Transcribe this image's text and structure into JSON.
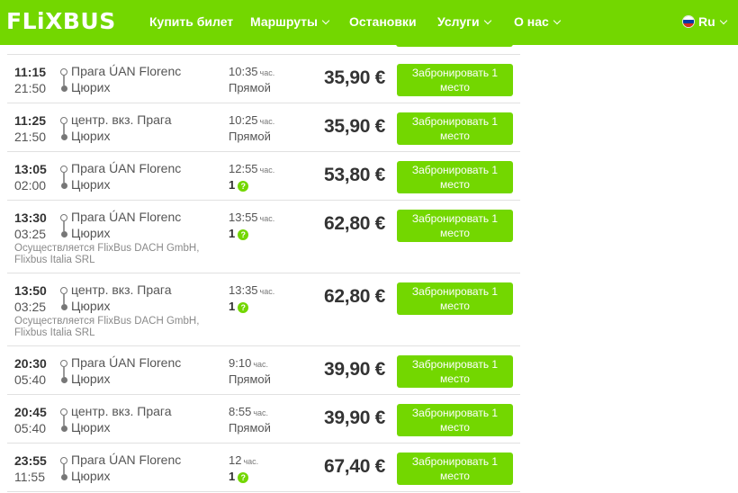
{
  "header": {
    "logo": "FLiXBUS",
    "nav": [
      {
        "label": "Купить билет",
        "dropdown": false
      },
      {
        "label": "Маршруты",
        "dropdown": true
      },
      {
        "label": "Остановки",
        "dropdown": false
      },
      {
        "label": "Услуги",
        "dropdown": true
      },
      {
        "label": "О нас",
        "dropdown": true
      }
    ],
    "language": "Ru",
    "accent_color": "#73d700"
  },
  "rides": [
    {
      "dep": "11:15",
      "arr": "21:50",
      "from": "Прага ÚAN Florenc",
      "to": "Цюрих",
      "duration": "10:35",
      "unit": "час.",
      "transfer": "Прямой",
      "transfer_num": false,
      "price": "35,90 €",
      "book": "Забронировать 1 место",
      "operator": ""
    },
    {
      "dep": "11:25",
      "arr": "21:50",
      "from": "центр. вкз. Прага",
      "to": "Цюрих",
      "duration": "10:25",
      "unit": "час.",
      "transfer": "Прямой",
      "transfer_num": false,
      "price": "35,90 €",
      "book": "Забронировать 1 место",
      "operator": ""
    },
    {
      "dep": "13:05",
      "arr": "02:00",
      "from": "Прага ÚAN Florenc",
      "to": "Цюрих",
      "duration": "12:55",
      "unit": "час.",
      "transfer": "1",
      "transfer_num": true,
      "price": "53,80 €",
      "book": "Забронировать 1 место",
      "operator": ""
    },
    {
      "dep": "13:30",
      "arr": "03:25",
      "from": "Прага ÚAN Florenc",
      "to": "Цюрих",
      "duration": "13:55",
      "unit": "час.",
      "transfer": "1",
      "transfer_num": true,
      "price": "62,80 €",
      "book": "Забронировать 1 место",
      "operator": "Осуществляется FlixBus DACH GmbH, Flixbus Italia SRL"
    },
    {
      "dep": "13:50",
      "arr": "03:25",
      "from": "центр. вкз. Прага",
      "to": "Цюрих",
      "duration": "13:35",
      "unit": "час.",
      "transfer": "1",
      "transfer_num": true,
      "price": "62,80 €",
      "book": "Забронировать 1 место",
      "operator": "Осуществляется FlixBus DACH GmbH, Flixbus Italia SRL"
    },
    {
      "dep": "20:30",
      "arr": "05:40",
      "from": "Прага ÚAN Florenc",
      "to": "Цюрих",
      "duration": "9:10",
      "unit": "час.",
      "transfer": "Прямой",
      "transfer_num": false,
      "price": "39,90 €",
      "book": "Забронировать 1 место",
      "operator": ""
    },
    {
      "dep": "20:45",
      "arr": "05:40",
      "from": "центр. вкз. Прага",
      "to": "Цюрих",
      "duration": "8:55",
      "unit": "час.",
      "transfer": "Прямой",
      "transfer_num": false,
      "price": "39,90 €",
      "book": "Забронировать 1 место",
      "operator": ""
    },
    {
      "dep": "23:55",
      "arr": "11:55",
      "from": "Прага ÚAN Florenc",
      "to": "Цюрих",
      "duration": "12",
      "unit": "час.",
      "transfer": "1",
      "transfer_num": true,
      "price": "67,40 €",
      "book": "Забронировать 1 место",
      "operator": ""
    }
  ]
}
